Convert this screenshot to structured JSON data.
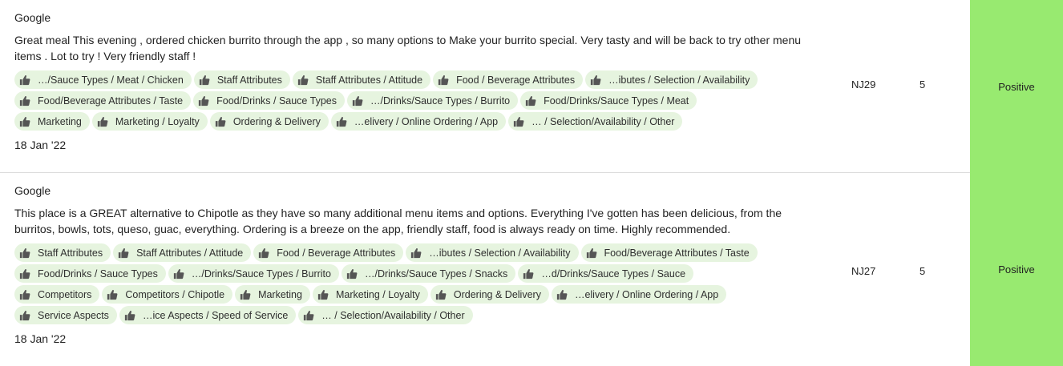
{
  "reviews": [
    {
      "source": "Google",
      "text": "Great meal This evening , ordered chicken burrito through the app , so many options to Make your burrito special. Very tasty and will be back to try other menu items . Lot to try ! Very friendly staff !",
      "tags": [
        "…/Sauce Types / Meat / Chicken",
        "Staff Attributes",
        "Staff Attributes / Attitude",
        "Food / Beverage Attributes",
        "…ibutes / Selection / Availability",
        "Food/Beverage Attributes / Taste",
        "Food/Drinks / Sauce Types",
        "…/Drinks/Sauce Types / Burrito",
        "Food/Drinks/Sauce Types / Meat",
        "Marketing",
        "Marketing / Loyalty",
        "Ordering & Delivery",
        "…elivery / Online Ordering / App",
        "… / Selection/Availability / Other"
      ],
      "date": "18 Jan '22",
      "store": "NJ29",
      "rating": "5",
      "sentiment": "Positive"
    },
    {
      "source": "Google",
      "text": "This place is a GREAT alternative to Chipotle as they have so many additional menu items and options. Everything I've gotten has been delicious, from the burritos, bowls, tots, queso, guac, everything. Ordering is a breeze on the app, friendly staff, food is always ready on time. Highly recommended.",
      "tags": [
        "Staff Attributes",
        "Staff Attributes / Attitude",
        "Food / Beverage Attributes",
        "…ibutes / Selection / Availability",
        "Food/Beverage Attributes / Taste",
        "Food/Drinks / Sauce Types",
        "…/Drinks/Sauce Types / Burrito",
        "…/Drinks/Sauce Types / Snacks",
        "…d/Drinks/Sauce Types / Sauce",
        "Competitors",
        "Competitors / Chipotle",
        "Marketing",
        "Marketing / Loyalty",
        "Ordering & Delivery",
        "…elivery / Online Ordering / App",
        "Service Aspects",
        "…ice Aspects / Speed of Service",
        "… / Selection/Availability / Other"
      ],
      "date": "18 Jan '22",
      "store": "NJ27",
      "rating": "5",
      "sentiment": "Positive"
    }
  ],
  "tag_icon": "thumbs-up-icon",
  "colors": {
    "tag_bg": "#e6f4df",
    "positive_bg": "#98ea70",
    "icon": "#555555"
  }
}
